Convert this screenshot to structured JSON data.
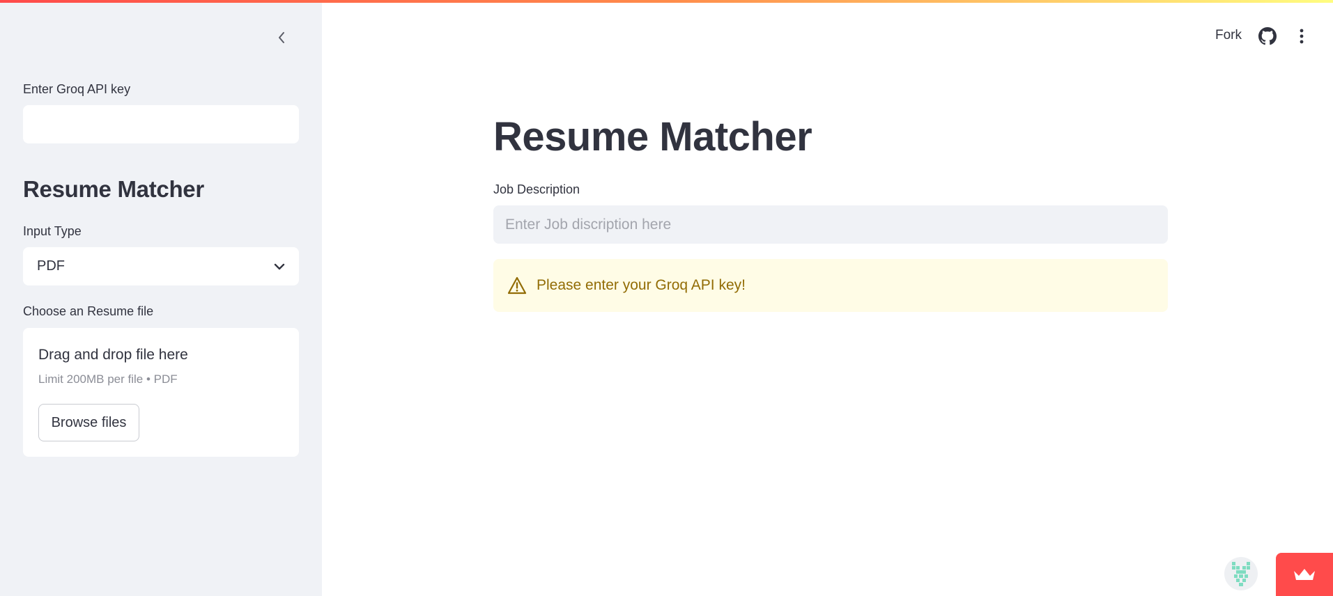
{
  "sidebar": {
    "api_key_label": "Enter Groq API key",
    "api_key_value": "",
    "heading": "Resume Matcher",
    "input_type_label": "Input Type",
    "input_type_selected": "PDF",
    "file_label": "Choose an Resume file",
    "uploader": {
      "title": "Drag and drop file here",
      "subtitle": "Limit 200MB per file • PDF",
      "browse_label": "Browse files"
    }
  },
  "header": {
    "fork_label": "Fork"
  },
  "main": {
    "title": "Resume Matcher",
    "job_description_label": "Job Description",
    "job_description_placeholder": "Enter Job discription here",
    "warning_text": "Please enter your Groq API key!"
  },
  "icons": {
    "collapse": "chevron-left-icon",
    "select": "chevron-down-icon",
    "github": "github-icon",
    "menu": "more-vertical-icon",
    "warning": "warning-icon",
    "badge": "crown-icon"
  },
  "colors": {
    "accent": "#ff4b4b",
    "sidebar_bg": "#f0f2f6",
    "warning_bg": "#fffce6",
    "warning_text": "#926c05"
  }
}
